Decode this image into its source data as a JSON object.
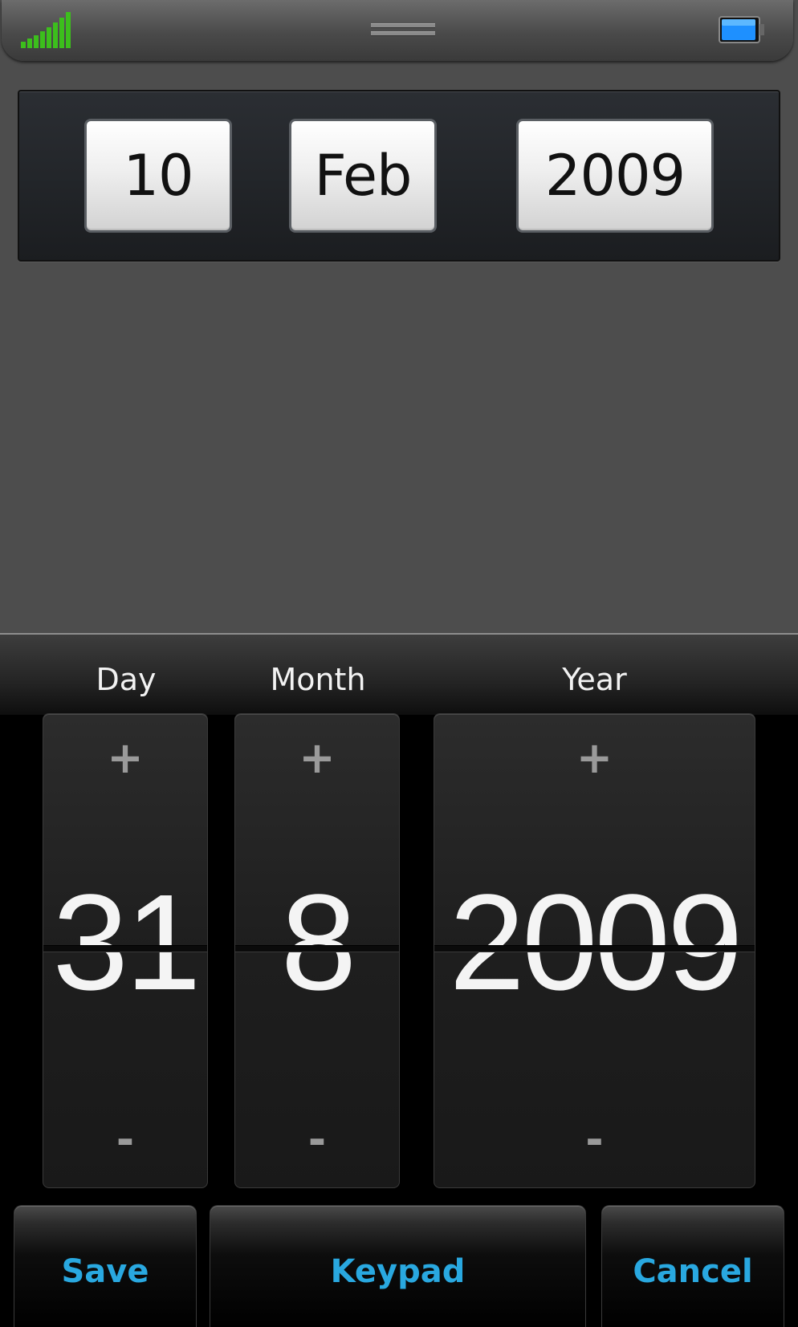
{
  "status_bar": {
    "signal_icon": "signal-strength-icon",
    "grip_icon": "drag-handle-icon",
    "battery_icon": "battery-icon",
    "signal_color": "#3cbf1c",
    "battery_color": "#1e90ff"
  },
  "selected_date": {
    "day": "10",
    "month": "Feb",
    "year": "2009"
  },
  "picker": {
    "columns": [
      {
        "label": "Day",
        "value": "31",
        "plus": "+",
        "minus": "-"
      },
      {
        "label": "Month",
        "value": "8",
        "plus": "+",
        "minus": "-"
      },
      {
        "label": "Year",
        "value": "2009",
        "plus": "+",
        "minus": "-"
      }
    ]
  },
  "buttons": {
    "save": "Save",
    "keypad": "Keypad",
    "cancel": "Cancel",
    "accent_color": "#29a8e0"
  }
}
